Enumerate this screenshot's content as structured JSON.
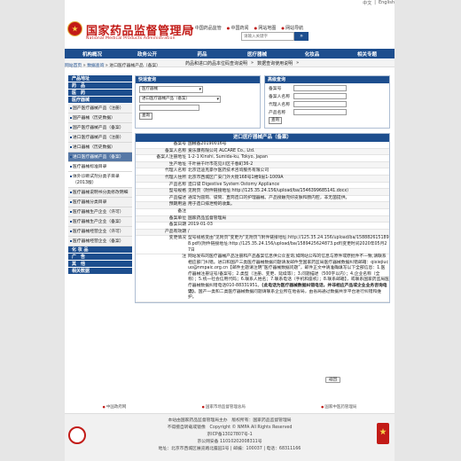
{
  "lang": {
    "zh": "中文",
    "sep": "|",
    "en": "English"
  },
  "header": {
    "title": "国家药品监督管理局",
    "subtitle": "National Medical Products Administration",
    "quicklinks": [
      "中国药品监管",
      "中国药闻",
      "网站地图",
      "网站导航"
    ],
    "search_placeholder": "请输入关键字",
    "search_button": "»"
  },
  "nav": [
    "机构概况",
    "政务公开",
    "药品",
    "医疗器械",
    "化妆品",
    "相关专题"
  ],
  "marquee": {
    "item1": "药品和进口药品本位码查询说明",
    "sep": "»",
    "item2": "数据查询使用说明",
    "more": "»"
  },
  "breadcrumb": {
    "home": "网站首页",
    "sep1": " » ",
    "level1": "数据查询",
    "sep2": " » ",
    "current": "进口医疗器械产品（备案）"
  },
  "sidebar": {
    "sections": [
      {
        "heading": "产品地址",
        "items": []
      },
      {
        "heading": "药　品",
        "items": []
      },
      {
        "heading": "医　药",
        "items": []
      },
      {
        "heading": "医疗器械",
        "items": [
          {
            "label": "国产医疗器械产品（注册）",
            "state": ""
          },
          {
            "label": "国产器械（历史数据）",
            "state": ""
          },
          {
            "label": "国产医疗器械产品（备案）",
            "state": ""
          },
          {
            "label": "进口医疗器械产品（注册）",
            "state": ""
          },
          {
            "label": "进口器械（历史数据）",
            "state": ""
          },
          {
            "label": "进口医疗器械产品（备案）",
            "state": "active"
          },
          {
            "label": "医疗器械标准目录",
            "state": "white"
          },
          {
            "label": "体外诊断试剂分类子目录（2013版）",
            "state": "white"
          },
          {
            "label": "医疗器械说明书分类修改明细",
            "state": ""
          },
          {
            "label": "医疗器械分类目录",
            "state": ""
          },
          {
            "label": "医疗器械生产企业（许可）",
            "state": ""
          },
          {
            "label": "医疗器械生产企业（备案）",
            "state": ""
          },
          {
            "label": "医疗器械经营企业（许可）",
            "state": ""
          },
          {
            "label": "医疗器械经营企业（备案）",
            "state": ""
          }
        ]
      },
      {
        "heading": "化 妆 品",
        "items": []
      },
      {
        "heading": "广　告",
        "items": []
      },
      {
        "heading": "其　他",
        "items": []
      },
      {
        "heading": "相关数据",
        "items": []
      }
    ]
  },
  "query": {
    "heading": "快速查询",
    "select1": "医疗器械",
    "select2": "进口医疗器械产品（备案）",
    "button": "查询"
  },
  "advanced": {
    "heading": "高级查询",
    "fields": [
      "备案号",
      "备案人名称",
      "代理人名称",
      "产品名称"
    ],
    "button": "查询"
  },
  "detail": {
    "title": "进口医疗器械产品（备案）",
    "rows": [
      {
        "k": "备案号",
        "v": "国械备20190016号"
      },
      {
        "k": "备案人名称",
        "v": "爱乐康有限公司 ALCARE Co., Ltd."
      },
      {
        "k": "备案人注册地址",
        "v": "1-2-1 Kinshi, Sumida-ku, Tokyo, Japan"
      },
      {
        "k": "生产地址",
        "v": "千叶县千叶市花见川区千春町36-2"
      },
      {
        "k": "代理人名称",
        "v": "北京迈迪克豪尔医药技术咨询服务有限公司"
      },
      {
        "k": "代理人住所",
        "v": "北京市西城区广安门外大街168号1楼9层1-1009A"
      },
      {
        "k": "产品名称",
        "v": "造口袋 Digestive System Ostomy Appliance"
      },
      {
        "k": "型号规格",
        "v": "见附页（附件链接地址:http://125.35.24.156/upload/ba/1546399685141.docx）"
      },
      {
        "k": "产品描述",
        "v": "通常为圆筒、袋筒、直筒造口的护理器械。产品接触完好皮肤和肠内腔，非无菌提供。"
      },
      {
        "k": "预期用途",
        "v": "用于造口排泄物的收集。"
      },
      {
        "k": "备注",
        "v": ""
      },
      {
        "k": "备案单位",
        "v": "国家药品监督管理局"
      },
      {
        "k": "备案日期",
        "v": "2019-01-03"
      },
      {
        "k": "产品有效期",
        "v": "/"
      },
      {
        "k": "变更情况",
        "v": "型号规格变由\"见附页\"变更为\"见附页\"(附件链接地址:http://125.35.24.156/upload/ba/1588826151898.pdf)(附件链接地址:http://125.35.24.156/upload/ba/1589425624873.pdf)变更时间2020年05月27日"
      }
    ],
    "note_pre": "注",
    "note_body": "网站发布的医疗器械产品注册和产品备案信息供公众查询,如网站公布的信息与原件或原批件不一致,请联系相应部门纠错。进口和国产三类医疗器械数据问题请发邮件至国家药监局医疗器械数据纠错邮箱：qixiejiucuo@nmpaic.org.cn【邮件主题请注明“医疗器械数据问题”，邮件正文中请准确填写以下全部信息：1.医疗器械注册证号/备案号；2.类型（注册、变更、延续等）；3.问题描述（500字以内）；4.企业名称（全称）；5.统一社会信用代码；6.联系人姓名；7.联系电话（手机和座机）；8.联系邮箱】，或联系国家药监局医疗器械数据纠错电话010-88331951。",
    "note_bold": "(此电话为医疗器械数据纠错电话，并非相应产品或企业业务咨询电话)",
    "note_tail": "。国产一类和二类医疗器械数据问题请联系企业所在地省局，由省局通过数据共享平台进行纠错和维护。",
    "back_button": "返回"
  },
  "footer_links": [
    "中国政府网",
    "国家市场监督管理总局",
    "国家中医药管理局"
  ],
  "footer": {
    "line1": "本站由国家药品监督管理局主办　版权所有：国家药品监督管理局",
    "line2": "不得擅自转载或镜像　Copyright © NMPA All Rights Reserved",
    "line3": "京ICP备13027807号-1",
    "line4_pre": "京公网安备",
    "line4": "11010202008311号",
    "line5": "地址：北京市西城区展览路北露园1号 | 邮编：100037 | 电话：68311166",
    "badge_label": "党政机关"
  },
  "colors": {
    "brand_blue": "#1d4e8e",
    "brand_red": "#c21b17"
  }
}
